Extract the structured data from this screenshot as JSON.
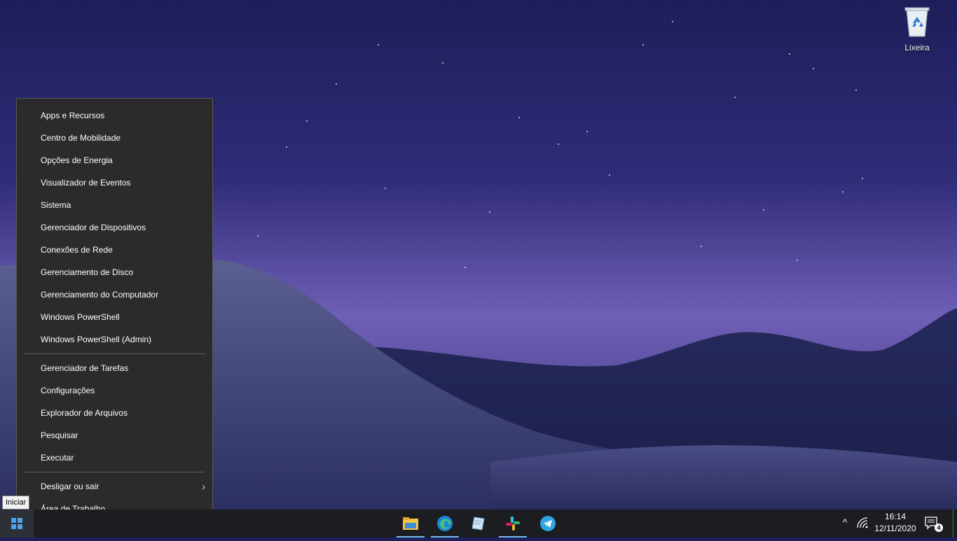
{
  "desktop": {
    "recycle_bin_label": "Lixeira"
  },
  "menu": {
    "group1": [
      "Apps e Recursos",
      "Centro de Mobilidade",
      "Opções de Energia",
      "Visualizador de Eventos",
      "Sistema",
      "Gerenciador de Dispositivos",
      "Conexões de Rede",
      "Gerenciamento de Disco",
      "Gerenciamento do Computador",
      "Windows PowerShell",
      "Windows PowerShell (Admin)"
    ],
    "group2": [
      "Gerenciador de Tarefas",
      "Configurações",
      "Explorador de Arquivos",
      "Pesquisar",
      "Executar"
    ],
    "group3": [
      "Desligar ou sair",
      "Área de Trabalho"
    ],
    "submenu_chevron": "›"
  },
  "tooltip": {
    "start": "Iniciar"
  },
  "taskbar": {
    "apps": [
      {
        "name": "file-explorer-icon",
        "active": true
      },
      {
        "name": "edge-icon",
        "active": true
      },
      {
        "name": "notepad-icon",
        "active": false
      },
      {
        "name": "slack-icon",
        "active": true
      },
      {
        "name": "telegram-icon",
        "active": false
      }
    ],
    "tray_chevron": "^",
    "clock_time": "16:14",
    "clock_date": "12/11/2020",
    "notification_count": "4"
  },
  "colors": {
    "menu_bg": "#2b2b2b",
    "taskbar_bg": "#1c1d21",
    "accent": "#76b9ed"
  }
}
